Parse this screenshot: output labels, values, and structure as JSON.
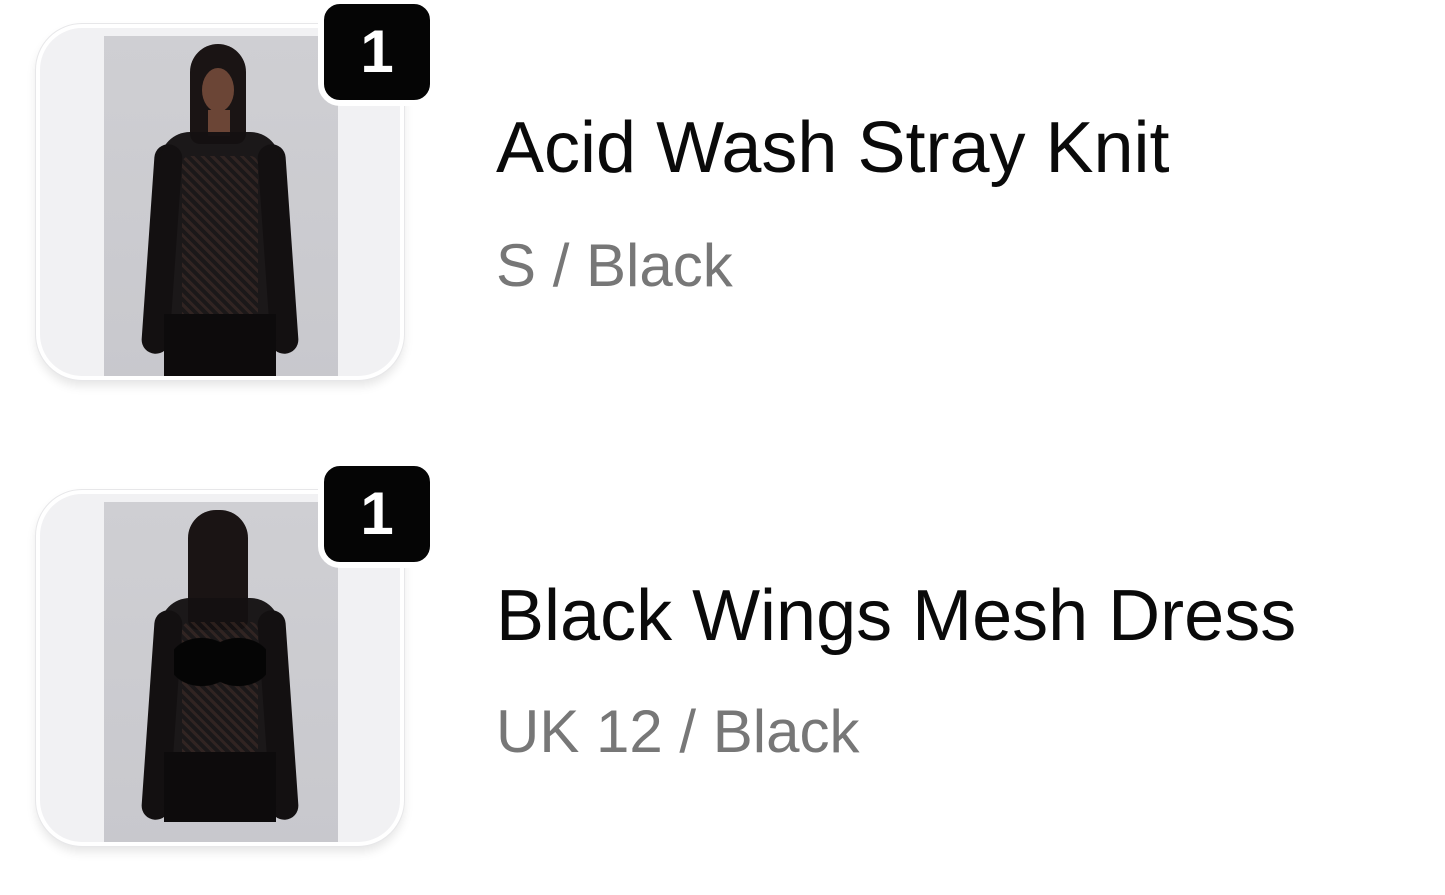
{
  "cart": {
    "items": [
      {
        "quantity": "1",
        "title": "Acid Wash Stray Knit",
        "variant": "S / Black",
        "image_icon": "product-photo-front-knit-top"
      },
      {
        "quantity": "1",
        "title": "Black Wings Mesh Dress",
        "variant": "UK 12 / Black",
        "image_icon": "product-photo-back-mesh-dress"
      }
    ]
  },
  "colors": {
    "title_text": "#0a0a0a",
    "variant_text": "#777777",
    "badge_bg": "#050505",
    "badge_text": "#ffffff",
    "thumb_bg": "#f1f1f3"
  }
}
